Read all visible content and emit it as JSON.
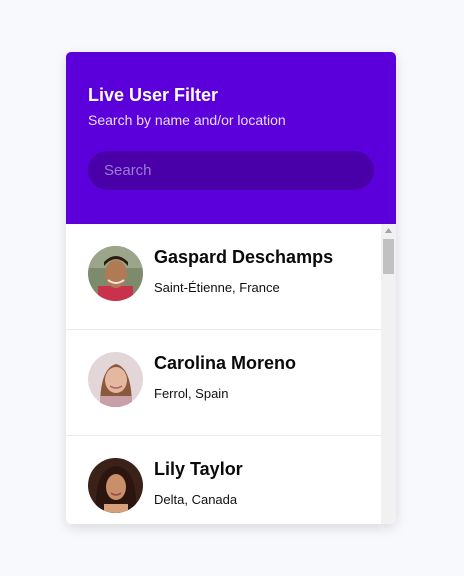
{
  "header": {
    "title": "Live User Filter",
    "subtitle": "Search by name and/or location",
    "search_placeholder": "Search"
  },
  "users": [
    {
      "name": "Gaspard Deschamps",
      "location": "Saint-Étienne, France"
    },
    {
      "name": "Carolina Moreno",
      "location": "Ferrol, Spain"
    },
    {
      "name": "Lily Taylor",
      "location": "Delta, Canada"
    }
  ],
  "icons": {
    "scroll_up": "triangle-up-icon"
  },
  "colors": {
    "header_bg": "#5b00db",
    "search_bg": "#4a00a8",
    "page_bg": "#f8f9fd"
  }
}
